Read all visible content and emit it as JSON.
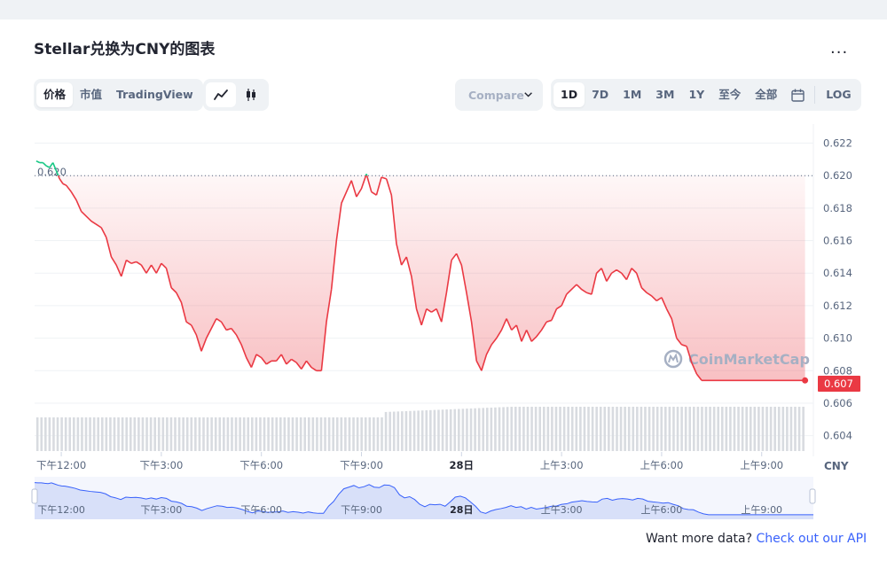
{
  "title": "Stellar兑换为CNY的图表",
  "more_label": "...",
  "tabs": {
    "price": "价格",
    "market_cap": "市值",
    "tradingview": "TradingView",
    "line_icon": "line-chart-icon",
    "candle_icon": "candlestick-icon"
  },
  "compare": {
    "label": "Compare",
    "icon": "chevron-down-icon"
  },
  "ranges": [
    "1D",
    "7D",
    "1M",
    "3M",
    "1Y",
    "至今",
    "全部"
  ],
  "active_range": "1D",
  "calendar_icon": "calendar-icon",
  "log_label": "LOG",
  "watermark": "CoinMarketCap",
  "footer": {
    "text": "Want more data?",
    "link": "Check out our API"
  },
  "colors": {
    "up": "#16c784",
    "down": "#ea3943",
    "navigator": "#3861fb",
    "volume": "#d8dbe0"
  },
  "chart_data": {
    "type": "line",
    "currency_label": "CNY",
    "open_price_label": "0.620",
    "current_price_label": "0.607",
    "ylim": [
      0.603,
      0.6229
    ],
    "y_ticks": [
      "0.622",
      "0.620",
      "0.618",
      "0.616",
      "0.614",
      "0.612",
      "0.610",
      "0.608",
      "0.606",
      "0.604"
    ],
    "x_ticks": [
      "下午12:00",
      "下午3:00",
      "下午6:00",
      "下午9:00",
      "28日",
      "上午3:00",
      "上午6:00",
      "上午9:00"
    ],
    "x_tick_hours": [
      0,
      3,
      6,
      9,
      12,
      15,
      18,
      21
    ],
    "open_price": 0.62,
    "grid": true,
    "series": [
      {
        "x": [
          -0.75,
          -0.65,
          -0.55,
          -0.45,
          -0.35,
          -0.25,
          -0.15,
          -0.05,
          0.05,
          0.15,
          0.3,
          0.45,
          0.6,
          0.75,
          0.9,
          1.05,
          1.2,
          1.35,
          1.5,
          1.65,
          1.8,
          1.95,
          2.1,
          2.25,
          2.4,
          2.55,
          2.7,
          2.85,
          3.0,
          3.15,
          3.3,
          3.45,
          3.6,
          3.75,
          3.9,
          4.05,
          4.2,
          4.35,
          4.5,
          4.65,
          4.8,
          4.95,
          5.1,
          5.25,
          5.4,
          5.55,
          5.7,
          5.85,
          6.0,
          6.15,
          6.3,
          6.45,
          6.6,
          6.75,
          6.9,
          7.05,
          7.2,
          7.35,
          7.5,
          7.65,
          7.8,
          7.95,
          8.1,
          8.25,
          8.4,
          8.55,
          8.7,
          8.85,
          9.0,
          9.15,
          9.3,
          9.45,
          9.6,
          9.75,
          9.9,
          10.05,
          10.2,
          10.35,
          10.5,
          10.65,
          10.8,
          10.95,
          11.1,
          11.25,
          11.4,
          11.55,
          11.7,
          11.85,
          12.0,
          12.15,
          12.3,
          12.45,
          12.6,
          12.75,
          12.9,
          13.05,
          13.2,
          13.35,
          13.5,
          13.65,
          13.8,
          13.95,
          14.1,
          14.25,
          14.4,
          14.55,
          14.7,
          14.85,
          15.0,
          15.15,
          15.3,
          15.45,
          15.6,
          15.75,
          15.9,
          16.05,
          16.2,
          16.35,
          16.5,
          16.65,
          16.8,
          16.95,
          17.1,
          17.25,
          17.4,
          17.55,
          17.7,
          17.85,
          18.0,
          18.15,
          18.3,
          18.45,
          18.6,
          18.75,
          18.9,
          19.05,
          19.2,
          19.35,
          19.5,
          19.65,
          19.8,
          19.95,
          20.1,
          20.25,
          20.4,
          20.55,
          20.7,
          20.85,
          21.0,
          21.15,
          21.3,
          21.45,
          21.6,
          21.75,
          21.9,
          22.05,
          22.2,
          22.3
        ],
        "y": [
          0.6209,
          0.6208,
          0.6208,
          0.6206,
          0.6205,
          0.6208,
          0.6203,
          0.6198,
          0.6195,
          0.6194,
          0.619,
          0.6185,
          0.6178,
          0.6175,
          0.6172,
          0.617,
          0.6168,
          0.6162,
          0.615,
          0.6145,
          0.6138,
          0.6148,
          0.6146,
          0.6147,
          0.6145,
          0.614,
          0.6145,
          0.614,
          0.6146,
          0.6143,
          0.6131,
          0.6128,
          0.6122,
          0.611,
          0.6108,
          0.6102,
          0.6092,
          0.61,
          0.6106,
          0.6112,
          0.611,
          0.6105,
          0.6106,
          0.6102,
          0.6096,
          0.6088,
          0.6082,
          0.609,
          0.6088,
          0.6084,
          0.6086,
          0.6086,
          0.609,
          0.6084,
          0.6087,
          0.6085,
          0.6081,
          0.6086,
          0.6082,
          0.608,
          0.608,
          0.611,
          0.613,
          0.616,
          0.6183,
          0.619,
          0.6197,
          0.6187,
          0.6192,
          0.6201,
          0.619,
          0.6188,
          0.6199,
          0.6198,
          0.6188,
          0.6158,
          0.6145,
          0.615,
          0.6138,
          0.6118,
          0.6108,
          0.6118,
          0.6116,
          0.6118,
          0.611,
          0.6128,
          0.6148,
          0.6152,
          0.6145,
          0.6128,
          0.611,
          0.6086,
          0.608,
          0.609,
          0.6096,
          0.61,
          0.6105,
          0.6112,
          0.6105,
          0.6108,
          0.6098,
          0.6105,
          0.6098,
          0.6101,
          0.6105,
          0.611,
          0.6111,
          0.6118,
          0.612,
          0.6127,
          0.613,
          0.6133,
          0.613,
          0.6128,
          0.6127,
          0.614,
          0.6143,
          0.6135,
          0.614,
          0.6142,
          0.614,
          0.6136,
          0.6143,
          0.614,
          0.6131,
          0.6128,
          0.6126,
          0.6123,
          0.6125,
          0.6118,
          0.6112,
          0.61,
          0.6096,
          0.6095,
          0.6085,
          0.6078,
          0.6074,
          0.6074,
          0.6074,
          0.6074,
          0.6074,
          0.6074,
          0.6074,
          0.6074,
          0.6074,
          0.6074,
          0.6074,
          0.6074,
          0.6074,
          0.6074,
          0.6074,
          0.6074,
          0.6074,
          0.6074,
          0.6074,
          0.6074,
          0.6074,
          0.6074
        ]
      }
    ]
  }
}
